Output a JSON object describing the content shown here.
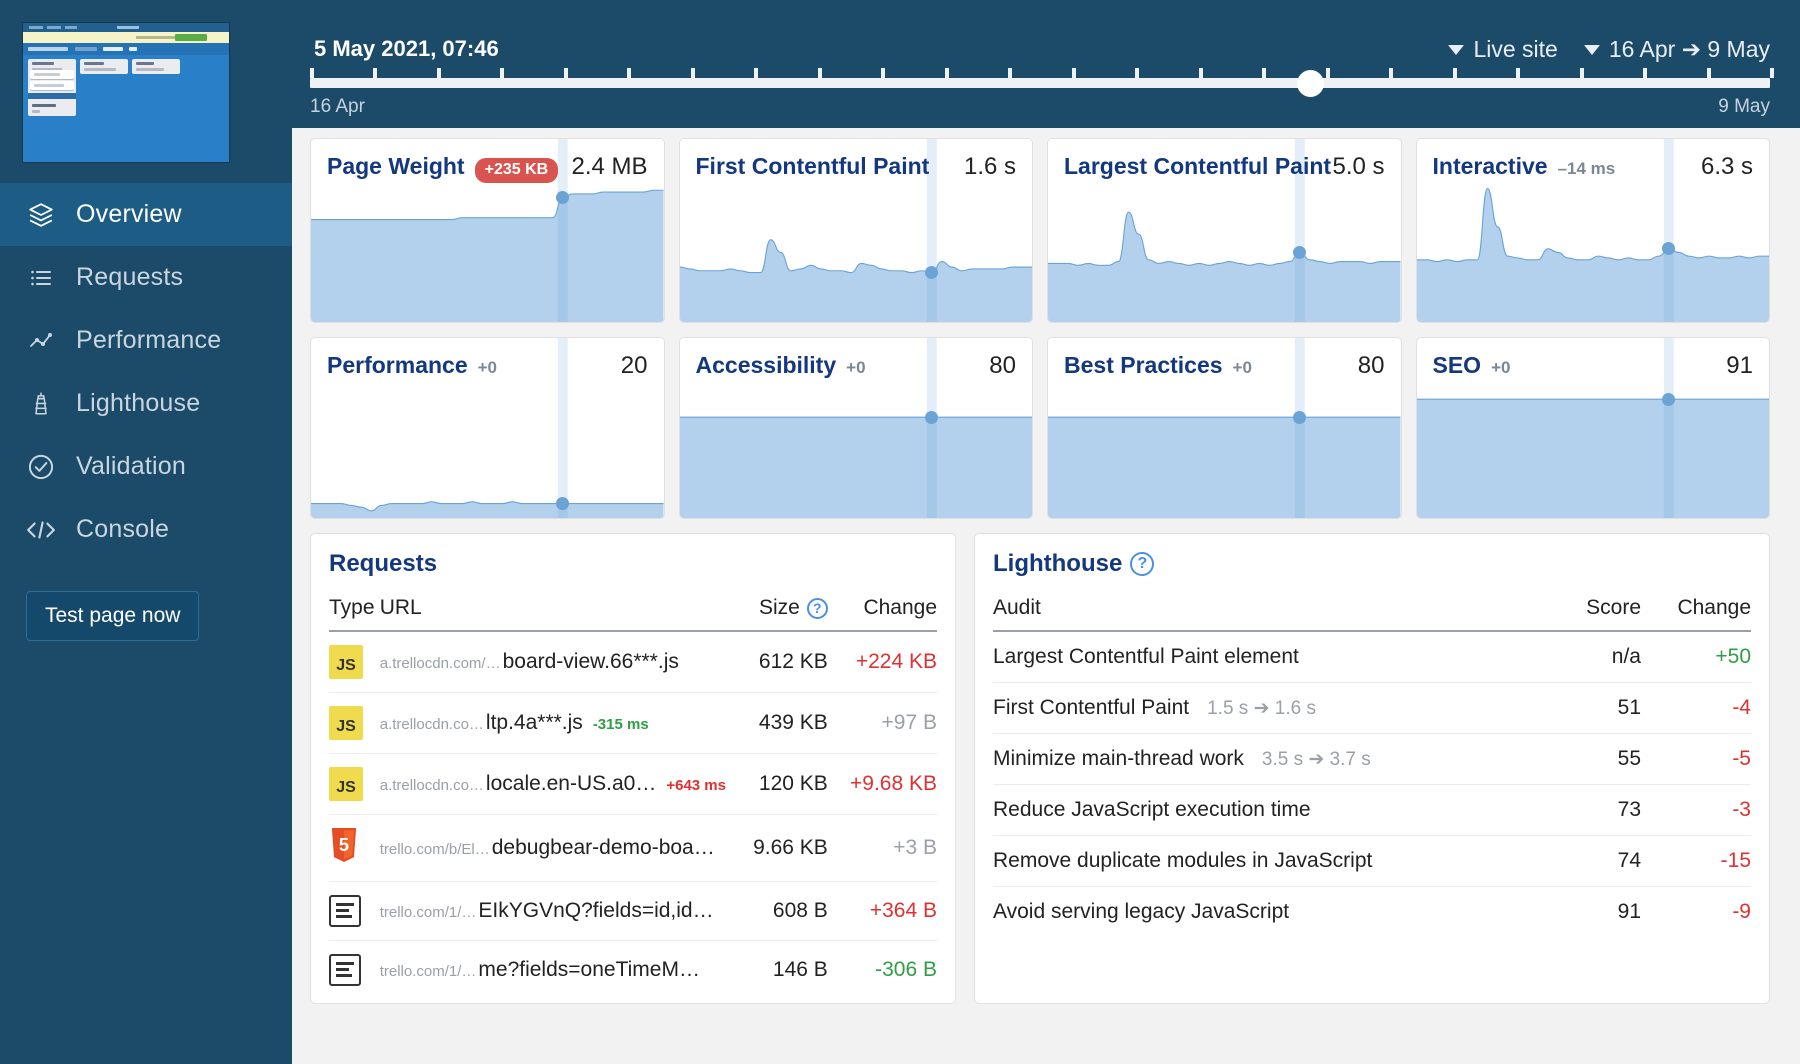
{
  "sidebar": {
    "thumbnail_name": "site-screenshot-thumbnail",
    "items": [
      {
        "label": "Overview",
        "icon": "layers-icon",
        "active": true
      },
      {
        "label": "Requests",
        "icon": "list-icon",
        "active": false
      },
      {
        "label": "Performance",
        "icon": "line-chart-icon",
        "active": false
      },
      {
        "label": "Lighthouse",
        "icon": "lighthouse-icon",
        "active": false
      },
      {
        "label": "Validation",
        "icon": "check-circle-icon",
        "active": false
      },
      {
        "label": "Console",
        "icon": "code-icon",
        "active": false
      }
    ],
    "test_button": "Test page now"
  },
  "topbar": {
    "snapshot_date": "5 May 2021, 07:46",
    "site_selector": "Live site",
    "range_selector": "16 Apr ➔ 9 May",
    "timeline_start": "16 Apr",
    "timeline_end": "9 May",
    "handle_position_pct": 68.5
  },
  "metric_cards": [
    {
      "title": "Page Weight",
      "badge": "+235 KB",
      "delta": null,
      "value": "2.4 MB"
    },
    {
      "title": "First Contentful Paint",
      "badge": null,
      "delta": null,
      "value": "1.6 s"
    },
    {
      "title": "Largest Contentful Paint",
      "badge": null,
      "delta": null,
      "value": "5.0 s"
    },
    {
      "title": "Interactive",
      "badge": null,
      "delta": "–14 ms",
      "value": "6.3 s"
    }
  ],
  "score_cards": [
    {
      "title": "Performance",
      "delta": "+0",
      "value": "20"
    },
    {
      "title": "Accessibility",
      "delta": "+0",
      "value": "80"
    },
    {
      "title": "Best Practices",
      "delta": "+0",
      "value": "80"
    },
    {
      "title": "SEO",
      "delta": "+0",
      "value": "91"
    }
  ],
  "requests": {
    "title": "Requests",
    "columns": {
      "type": "Type",
      "url": "URL",
      "size": "Size",
      "change": "Change"
    },
    "rows": [
      {
        "icon": "js-file-icon",
        "url_prefix": "a.trellocdn.com/…",
        "url": "board-view.66***.js",
        "time": null,
        "time_sign": null,
        "size": "612 KB",
        "change": "+224 KB",
        "change_sign": "pos"
      },
      {
        "icon": "js-file-icon",
        "url_prefix": "a.trellocdn.co…",
        "url": "ltp.4a***.js",
        "time": "-315 ms",
        "time_sign": "neg",
        "size": "439 KB",
        "change": "+97 B",
        "change_sign": "mut"
      },
      {
        "icon": "js-file-icon",
        "url_prefix": "a.trellocdn.co…",
        "url": "locale.en-US.a0…",
        "time": "+643 ms",
        "time_sign": "pos",
        "size": "120 KB",
        "change": "+9.68 KB",
        "change_sign": "pos"
      },
      {
        "icon": "html-file-icon",
        "url_prefix": "trello.com/b/El…",
        "url": "debugbear-demo-boa…",
        "time": null,
        "time_sign": null,
        "size": "9.66 KB",
        "change": "+3 B",
        "change_sign": "mut"
      },
      {
        "icon": "doc-file-icon",
        "url_prefix": "trello.com/1/…",
        "url": "EIkYGVnQ?fields=id,id…",
        "time": null,
        "time_sign": null,
        "size": "608 B",
        "change": "+364 B",
        "change_sign": "pos"
      },
      {
        "icon": "doc-file-icon",
        "url_prefix": "trello.com/1/…",
        "url": "me?fields=oneTimeM…",
        "time": null,
        "time_sign": null,
        "size": "146 B",
        "change": "-306 B",
        "change_sign": "neg"
      }
    ]
  },
  "lighthouse": {
    "title": "Lighthouse",
    "columns": {
      "audit": "Audit",
      "score": "Score",
      "change": "Change"
    },
    "rows": [
      {
        "audit": "Largest Contentful Paint element",
        "detail": null,
        "score": "n/a",
        "change": "+50",
        "change_sign": "neg"
      },
      {
        "audit": "First Contentful Paint",
        "detail": "1.5 s ➔ 1.6 s",
        "score": "51",
        "change": "-4",
        "change_sign": "pos"
      },
      {
        "audit": "Minimize main-thread work",
        "detail": "3.5 s ➔ 3.7 s",
        "score": "55",
        "change": "-5",
        "change_sign": "pos"
      },
      {
        "audit": "Reduce JavaScript execution time",
        "detail": null,
        "score": "73",
        "change": "-3",
        "change_sign": "pos"
      },
      {
        "audit": "Remove duplicate modules in JavaScript",
        "detail": null,
        "score": "74",
        "change": "-15",
        "change_sign": "pos"
      },
      {
        "audit": "Avoid serving legacy JavaScript",
        "detail": null,
        "score": "91",
        "change": "-9",
        "change_sign": "pos"
      }
    ]
  },
  "colors": {
    "sidebar_bg": "#1c4a69",
    "sidebar_active": "#1d5c85",
    "accent_title": "#14387f",
    "badge_red": "#d9534f",
    "positive_red": "#e03131",
    "negative_green": "#2f9e44",
    "spark_fill": "#b3d0ec",
    "spark_line": "#6ba3d6"
  },
  "chart_data": [
    {
      "type": "area",
      "name": "Page Weight",
      "y_label": "MB",
      "baseline_pct": 56,
      "values": [
        56,
        56,
        56,
        56,
        56,
        56,
        56,
        56,
        56,
        56,
        56,
        56,
        56,
        56,
        56,
        57,
        57,
        57,
        57,
        57,
        57,
        57,
        57,
        57,
        57,
        68,
        70,
        70,
        70,
        71,
        71,
        71,
        71,
        71,
        72,
        72
      ],
      "marker_index": 25,
      "marker_value": 68
    },
    {
      "type": "area",
      "name": "First Contentful Paint",
      "y_label": "s",
      "baseline_pct": 28,
      "values": [
        30,
        29,
        28,
        28,
        28,
        29,
        28,
        27,
        27,
        45,
        38,
        28,
        29,
        31,
        29,
        28,
        28,
        27,
        32,
        31,
        29,
        28,
        28,
        27,
        28,
        27,
        33,
        30,
        28,
        29,
        29,
        29,
        29,
        30,
        30,
        30
      ],
      "marker_index": 25,
      "marker_value": 27
    },
    {
      "type": "area",
      "name": "Largest Contentful Paint",
      "y_label": "s",
      "baseline_pct": 32,
      "values": [
        32,
        32,
        32,
        31,
        32,
        31,
        31,
        33,
        60,
        48,
        34,
        32,
        33,
        32,
        31,
        32,
        31,
        32,
        33,
        32,
        31,
        32,
        31,
        32,
        33,
        38,
        34,
        33,
        32,
        33,
        33,
        33,
        32,
        33,
        33,
        33
      ],
      "marker_index": 25,
      "marker_value": 38
    },
    {
      "type": "area",
      "name": "Interactive",
      "y_label": "s",
      "baseline_pct": 34,
      "values": [
        34,
        34,
        33,
        34,
        33,
        34,
        34,
        73,
        52,
        36,
        35,
        34,
        34,
        40,
        38,
        35,
        34,
        34,
        36,
        35,
        34,
        35,
        34,
        34,
        36,
        40,
        38,
        36,
        35,
        36,
        35,
        35,
        36,
        35,
        36,
        36
      ],
      "marker_index": 25,
      "marker_value": 40
    },
    {
      "type": "area",
      "name": "Performance",
      "y_label": "score",
      "baseline_pct": 8,
      "values": [
        8,
        8,
        8,
        8,
        7,
        6,
        4,
        7,
        8,
        8,
        8,
        8,
        9,
        8,
        8,
        8,
        9,
        8,
        8,
        8,
        9,
        8,
        8,
        8,
        8,
        8,
        8,
        8,
        8,
        8,
        8,
        8,
        8,
        8,
        8,
        8
      ],
      "marker_index": 25,
      "marker_value": 8
    },
    {
      "type": "area",
      "name": "Accessibility",
      "y_label": "score",
      "baseline_pct": 56,
      "values": [
        56,
        56,
        56,
        56,
        56,
        56,
        56,
        56,
        56,
        56,
        56,
        56,
        56,
        56,
        56,
        56,
        56,
        56,
        56,
        56,
        56,
        56,
        56,
        56,
        56,
        56,
        56,
        56,
        56,
        56,
        56,
        56,
        56,
        56,
        56,
        56
      ],
      "marker_index": 25,
      "marker_value": 56
    },
    {
      "type": "area",
      "name": "Best Practices",
      "y_label": "score",
      "baseline_pct": 56,
      "values": [
        56,
        56,
        56,
        56,
        56,
        56,
        56,
        56,
        56,
        56,
        56,
        56,
        56,
        56,
        56,
        56,
        56,
        56,
        56,
        56,
        56,
        56,
        56,
        56,
        56,
        56,
        56,
        56,
        56,
        56,
        56,
        56,
        56,
        56,
        56,
        56
      ],
      "marker_index": 25,
      "marker_value": 56
    },
    {
      "type": "area",
      "name": "SEO",
      "y_label": "score",
      "baseline_pct": 66,
      "values": [
        66,
        66,
        66,
        66,
        66,
        66,
        66,
        66,
        66,
        66,
        66,
        66,
        66,
        66,
        66,
        66,
        66,
        66,
        66,
        66,
        66,
        66,
        66,
        66,
        66,
        66,
        66,
        66,
        66,
        66,
        66,
        66,
        66,
        66,
        66,
        66
      ],
      "marker_index": 25,
      "marker_value": 66
    }
  ]
}
